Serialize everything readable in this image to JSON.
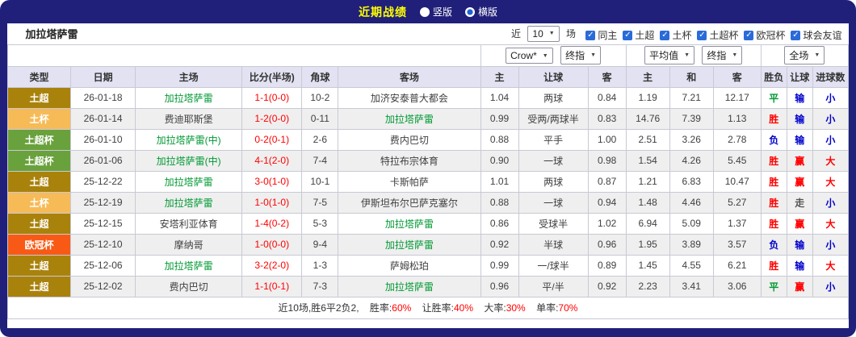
{
  "topbar": {
    "title": "近期战绩",
    "radio_vertical": "竖版",
    "radio_horizontal": "横版",
    "selected": "横版"
  },
  "filterbar": {
    "team_name": "加拉塔萨雷",
    "recent_label": "近",
    "match_count": "10",
    "matches_label": "场",
    "checkboxes": [
      {
        "label": "同主",
        "checked": true
      },
      {
        "label": "土超",
        "checked": true
      },
      {
        "label": "土杯",
        "checked": true
      },
      {
        "label": "土超杯",
        "checked": true
      },
      {
        "label": "欧冠杯",
        "checked": true
      },
      {
        "label": "球会友谊",
        "checked": true
      }
    ]
  },
  "selects": {
    "bookmaker": "Crow*",
    "bookmaker_stage": "终指",
    "average": "平均值",
    "average_stage": "终指",
    "scope": "全场"
  },
  "table": {
    "columns": [
      "类型",
      "日期",
      "主场",
      "比分(半场)",
      "角球",
      "客场",
      "主",
      "让球",
      "客",
      "主",
      "和",
      "客",
      "胜负",
      "让球",
      "进球数"
    ],
    "rows": [
      {
        "type": "土超",
        "date": "26-01-18",
        "home": "加拉塔萨雷",
        "score": "1-1(0-0)",
        "corner": "10-2",
        "away": "加济安泰普大都会",
        "odds": [
          "1.04",
          "两球",
          "0.84"
        ],
        "avg": [
          "1.19",
          "7.21",
          "12.17"
        ],
        "result": "平",
        "handicap_result": "输",
        "goals": "小",
        "target": "home"
      },
      {
        "type": "土杯",
        "date": "26-01-14",
        "home": "费迪耶斯堡",
        "score": "1-2(0-0)",
        "corner": "0-11",
        "away": "加拉塔萨雷",
        "odds": [
          "0.99",
          "受两/两球半",
          "0.83"
        ],
        "avg": [
          "14.76",
          "7.39",
          "1.13"
        ],
        "result": "胜",
        "handicap_result": "输",
        "goals": "小",
        "target": "away"
      },
      {
        "type": "土超杯",
        "date": "26-01-10",
        "home": "加拉塔萨雷(中)",
        "score": "0-2(0-1)",
        "corner": "2-6",
        "away": "费内巴切",
        "odds": [
          "0.88",
          "平手",
          "1.00"
        ],
        "avg": [
          "2.51",
          "3.26",
          "2.78"
        ],
        "result": "负",
        "handicap_result": "输",
        "goals": "小",
        "target": "home"
      },
      {
        "type": "土超杯",
        "date": "26-01-06",
        "home": "加拉塔萨雷(中)",
        "score": "4-1(2-0)",
        "corner": "7-4",
        "away": "特拉布宗体育",
        "odds": [
          "0.90",
          "一球",
          "0.98"
        ],
        "avg": [
          "1.54",
          "4.26",
          "5.45"
        ],
        "result": "胜",
        "handicap_result": "赢",
        "goals": "大",
        "target": "home"
      },
      {
        "type": "土超",
        "date": "25-12-22",
        "home": "加拉塔萨雷",
        "score": "3-0(1-0)",
        "corner": "10-1",
        "away": "卡斯帕萨",
        "odds": [
          "1.01",
          "两球",
          "0.87"
        ],
        "avg": [
          "1.21",
          "6.83",
          "10.47"
        ],
        "result": "胜",
        "handicap_result": "赢",
        "goals": "大",
        "target": "home"
      },
      {
        "type": "土杯",
        "date": "25-12-19",
        "home": "加拉塔萨雷",
        "score": "1-0(1-0)",
        "corner": "7-5",
        "away": "伊斯坦布尔巴萨克塞尔",
        "odds": [
          "0.88",
          "一球",
          "0.94"
        ],
        "avg": [
          "1.48",
          "4.46",
          "5.27"
        ],
        "result": "胜",
        "handicap_result": "走",
        "goals": "小",
        "target": "home"
      },
      {
        "type": "土超",
        "date": "25-12-15",
        "home": "安塔利亚体育",
        "score": "1-4(0-2)",
        "corner": "5-3",
        "away": "加拉塔萨雷",
        "odds": [
          "0.86",
          "受球半",
          "1.02"
        ],
        "avg": [
          "6.94",
          "5.09",
          "1.37"
        ],
        "result": "胜",
        "handicap_result": "赢",
        "goals": "大",
        "target": "away"
      },
      {
        "type": "欧冠杯",
        "date": "25-12-10",
        "home": "摩纳哥",
        "score": "1-0(0-0)",
        "corner": "9-4",
        "away": "加拉塔萨雷",
        "odds": [
          "0.92",
          "半球",
          "0.96"
        ],
        "avg": [
          "1.95",
          "3.89",
          "3.57"
        ],
        "result": "负",
        "handicap_result": "输",
        "goals": "小",
        "target": "away"
      },
      {
        "type": "土超",
        "date": "25-12-06",
        "home": "加拉塔萨雷",
        "score": "3-2(2-0)",
        "corner": "1-3",
        "away": "萨姆松珀",
        "odds": [
          "0.99",
          "一/球半",
          "0.89"
        ],
        "avg": [
          "1.45",
          "4.55",
          "6.21"
        ],
        "result": "胜",
        "handicap_result": "输",
        "goals": "大",
        "target": "home"
      },
      {
        "type": "土超",
        "date": "25-12-02",
        "home": "费内巴切",
        "score": "1-1(0-1)",
        "corner": "7-3",
        "away": "加拉塔萨雷",
        "odds": [
          "0.96",
          "平/半",
          "0.92"
        ],
        "avg": [
          "2.23",
          "3.41",
          "3.06"
        ],
        "result": "平",
        "handicap_result": "赢",
        "goals": "小",
        "target": "away"
      }
    ]
  },
  "footer": {
    "summary": "近10场,胜6平2负2,",
    "win_rate_label": "胜率:",
    "win_rate": "60%",
    "handicap_rate_label": "让胜率:",
    "handicap_rate": "40%",
    "big_rate_label": "大率:",
    "big_rate": "30%",
    "odd_rate_label": "单率:",
    "odd_rate": "70%"
  },
  "colors": {
    "target_team": "#009933",
    "other_team": "#404040",
    "score": "#ff0000",
    "type_colors": {
      "土超": "#A9820C",
      "土杯": "#F6BB57",
      "土超杯": "#69A13C",
      "欧冠杯": "#F85A16"
    },
    "outcome_colors": {
      "胜": "#ff0000",
      "平": "#009933",
      "负": "#0000cc",
      "赢": "#ff0000",
      "输": "#0000cc",
      "走": "#555555",
      "大": "#ff0000",
      "小": "#0000cc"
    }
  }
}
